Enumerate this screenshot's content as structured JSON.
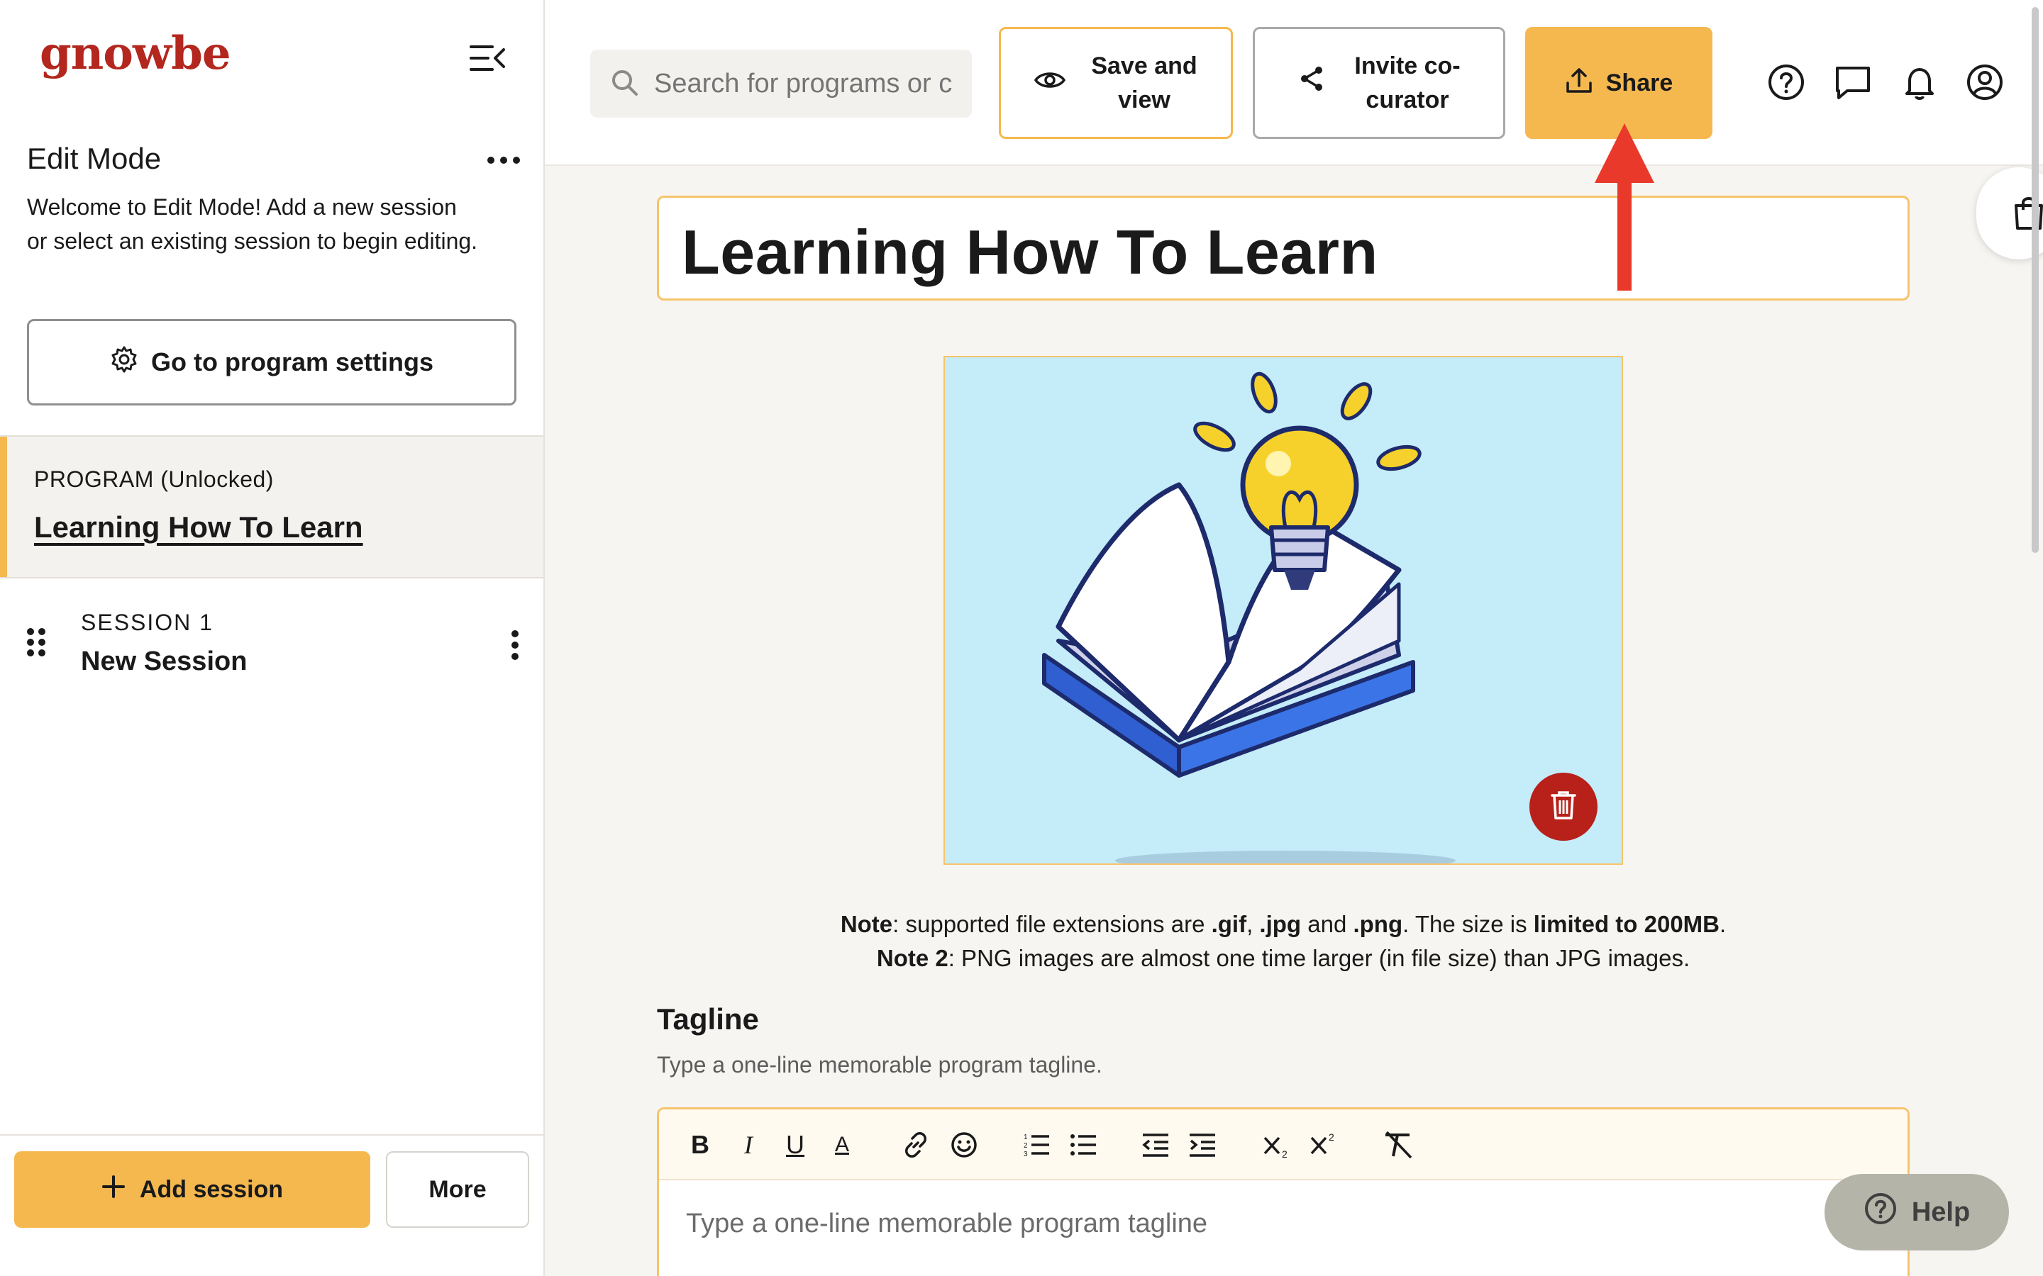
{
  "brand": {
    "logo_text": "gnowbe"
  },
  "sidebar": {
    "edit_title": "Edit Mode",
    "edit_desc": "Welcome to Edit Mode! Add a new session or select an existing session to begin editing.",
    "settings_label": "Go to program settings",
    "program_label": "PROGRAM (Unlocked)",
    "program_name": "Learning How To Learn",
    "session": {
      "label": "SESSION 1",
      "name": "New Session"
    },
    "add_session_label": "Add session",
    "more_label": "More"
  },
  "topbar": {
    "search_placeholder": "Search for programs or c",
    "save_label_1": "Save and",
    "save_label_2": "view",
    "invite_label_1": "Invite co-",
    "invite_label_2": "curator",
    "share_label": "Share"
  },
  "main": {
    "title": "Learning How To Learn",
    "note1": {
      "a": "Note",
      "b": ": supported file extensions are ",
      "gif": ".gif",
      "c": ", ",
      "jpg": ".jpg",
      "d": " and ",
      "png": ".png",
      "e": ". The size is ",
      "limit": "limited to 200MB",
      "f": "."
    },
    "note2": {
      "a": "Note 2",
      "b": ": PNG images are almost one time larger (in file size) than JPG images."
    },
    "tagline_heading": "Tagline",
    "tagline_desc": "Type a one-line memorable program tagline.",
    "tagline_placeholder": "Type a one-line memorable program tagline"
  },
  "toolbar_labels": {
    "bold": "B",
    "italic": "I",
    "underline": "U",
    "color": "A"
  },
  "help_label": "Help",
  "colors": {
    "accent": "#f5b84f",
    "brand": "#b3271e",
    "delete": "#b8201a",
    "arrow": "#e8392a"
  }
}
